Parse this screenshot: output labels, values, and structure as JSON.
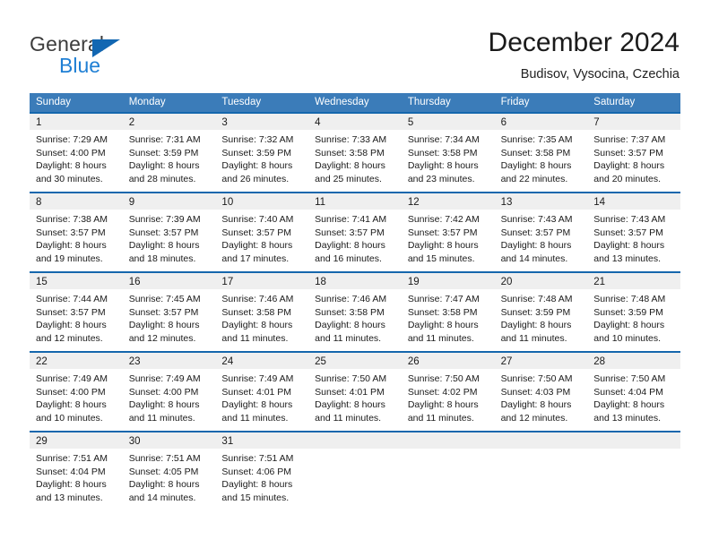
{
  "brand": {
    "name_part1": "General",
    "name_part2": "Blue",
    "triangle_color": "#1267b2",
    "blue_color": "#1f7fd4"
  },
  "header": {
    "title": "December 2024",
    "subtitle": "Budisov, Vysocina, Czechia"
  },
  "colors": {
    "header_row_bg": "#3b7cb9",
    "cell_top_border": "#1567ad",
    "day_band_bg": "#efefef"
  },
  "weekdays": [
    "Sunday",
    "Monday",
    "Tuesday",
    "Wednesday",
    "Thursday",
    "Friday",
    "Saturday"
  ],
  "weeks": [
    [
      {
        "day": "1",
        "sunrise": "Sunrise: 7:29 AM",
        "sunset": "Sunset: 4:00 PM",
        "daylight1": "Daylight: 8 hours",
        "daylight2": "and 30 minutes."
      },
      {
        "day": "2",
        "sunrise": "Sunrise: 7:31 AM",
        "sunset": "Sunset: 3:59 PM",
        "daylight1": "Daylight: 8 hours",
        "daylight2": "and 28 minutes."
      },
      {
        "day": "3",
        "sunrise": "Sunrise: 7:32 AM",
        "sunset": "Sunset: 3:59 PM",
        "daylight1": "Daylight: 8 hours",
        "daylight2": "and 26 minutes."
      },
      {
        "day": "4",
        "sunrise": "Sunrise: 7:33 AM",
        "sunset": "Sunset: 3:58 PM",
        "daylight1": "Daylight: 8 hours",
        "daylight2": "and 25 minutes."
      },
      {
        "day": "5",
        "sunrise": "Sunrise: 7:34 AM",
        "sunset": "Sunset: 3:58 PM",
        "daylight1": "Daylight: 8 hours",
        "daylight2": "and 23 minutes."
      },
      {
        "day": "6",
        "sunrise": "Sunrise: 7:35 AM",
        "sunset": "Sunset: 3:58 PM",
        "daylight1": "Daylight: 8 hours",
        "daylight2": "and 22 minutes."
      },
      {
        "day": "7",
        "sunrise": "Sunrise: 7:37 AM",
        "sunset": "Sunset: 3:57 PM",
        "daylight1": "Daylight: 8 hours",
        "daylight2": "and 20 minutes."
      }
    ],
    [
      {
        "day": "8",
        "sunrise": "Sunrise: 7:38 AM",
        "sunset": "Sunset: 3:57 PM",
        "daylight1": "Daylight: 8 hours",
        "daylight2": "and 19 minutes."
      },
      {
        "day": "9",
        "sunrise": "Sunrise: 7:39 AM",
        "sunset": "Sunset: 3:57 PM",
        "daylight1": "Daylight: 8 hours",
        "daylight2": "and 18 minutes."
      },
      {
        "day": "10",
        "sunrise": "Sunrise: 7:40 AM",
        "sunset": "Sunset: 3:57 PM",
        "daylight1": "Daylight: 8 hours",
        "daylight2": "and 17 minutes."
      },
      {
        "day": "11",
        "sunrise": "Sunrise: 7:41 AM",
        "sunset": "Sunset: 3:57 PM",
        "daylight1": "Daylight: 8 hours",
        "daylight2": "and 16 minutes."
      },
      {
        "day": "12",
        "sunrise": "Sunrise: 7:42 AM",
        "sunset": "Sunset: 3:57 PM",
        "daylight1": "Daylight: 8 hours",
        "daylight2": "and 15 minutes."
      },
      {
        "day": "13",
        "sunrise": "Sunrise: 7:43 AM",
        "sunset": "Sunset: 3:57 PM",
        "daylight1": "Daylight: 8 hours",
        "daylight2": "and 14 minutes."
      },
      {
        "day": "14",
        "sunrise": "Sunrise: 7:43 AM",
        "sunset": "Sunset: 3:57 PM",
        "daylight1": "Daylight: 8 hours",
        "daylight2": "and 13 minutes."
      }
    ],
    [
      {
        "day": "15",
        "sunrise": "Sunrise: 7:44 AM",
        "sunset": "Sunset: 3:57 PM",
        "daylight1": "Daylight: 8 hours",
        "daylight2": "and 12 minutes."
      },
      {
        "day": "16",
        "sunrise": "Sunrise: 7:45 AM",
        "sunset": "Sunset: 3:57 PM",
        "daylight1": "Daylight: 8 hours",
        "daylight2": "and 12 minutes."
      },
      {
        "day": "17",
        "sunrise": "Sunrise: 7:46 AM",
        "sunset": "Sunset: 3:58 PM",
        "daylight1": "Daylight: 8 hours",
        "daylight2": "and 11 minutes."
      },
      {
        "day": "18",
        "sunrise": "Sunrise: 7:46 AM",
        "sunset": "Sunset: 3:58 PM",
        "daylight1": "Daylight: 8 hours",
        "daylight2": "and 11 minutes."
      },
      {
        "day": "19",
        "sunrise": "Sunrise: 7:47 AM",
        "sunset": "Sunset: 3:58 PM",
        "daylight1": "Daylight: 8 hours",
        "daylight2": "and 11 minutes."
      },
      {
        "day": "20",
        "sunrise": "Sunrise: 7:48 AM",
        "sunset": "Sunset: 3:59 PM",
        "daylight1": "Daylight: 8 hours",
        "daylight2": "and 11 minutes."
      },
      {
        "day": "21",
        "sunrise": "Sunrise: 7:48 AM",
        "sunset": "Sunset: 3:59 PM",
        "daylight1": "Daylight: 8 hours",
        "daylight2": "and 10 minutes."
      }
    ],
    [
      {
        "day": "22",
        "sunrise": "Sunrise: 7:49 AM",
        "sunset": "Sunset: 4:00 PM",
        "daylight1": "Daylight: 8 hours",
        "daylight2": "and 10 minutes."
      },
      {
        "day": "23",
        "sunrise": "Sunrise: 7:49 AM",
        "sunset": "Sunset: 4:00 PM",
        "daylight1": "Daylight: 8 hours",
        "daylight2": "and 11 minutes."
      },
      {
        "day": "24",
        "sunrise": "Sunrise: 7:49 AM",
        "sunset": "Sunset: 4:01 PM",
        "daylight1": "Daylight: 8 hours",
        "daylight2": "and 11 minutes."
      },
      {
        "day": "25",
        "sunrise": "Sunrise: 7:50 AM",
        "sunset": "Sunset: 4:01 PM",
        "daylight1": "Daylight: 8 hours",
        "daylight2": "and 11 minutes."
      },
      {
        "day": "26",
        "sunrise": "Sunrise: 7:50 AM",
        "sunset": "Sunset: 4:02 PM",
        "daylight1": "Daylight: 8 hours",
        "daylight2": "and 11 minutes."
      },
      {
        "day": "27",
        "sunrise": "Sunrise: 7:50 AM",
        "sunset": "Sunset: 4:03 PM",
        "daylight1": "Daylight: 8 hours",
        "daylight2": "and 12 minutes."
      },
      {
        "day": "28",
        "sunrise": "Sunrise: 7:50 AM",
        "sunset": "Sunset: 4:04 PM",
        "daylight1": "Daylight: 8 hours",
        "daylight2": "and 13 minutes."
      }
    ],
    [
      {
        "day": "29",
        "sunrise": "Sunrise: 7:51 AM",
        "sunset": "Sunset: 4:04 PM",
        "daylight1": "Daylight: 8 hours",
        "daylight2": "and 13 minutes."
      },
      {
        "day": "30",
        "sunrise": "Sunrise: 7:51 AM",
        "sunset": "Sunset: 4:05 PM",
        "daylight1": "Daylight: 8 hours",
        "daylight2": "and 14 minutes."
      },
      {
        "day": "31",
        "sunrise": "Sunrise: 7:51 AM",
        "sunset": "Sunset: 4:06 PM",
        "daylight1": "Daylight: 8 hours",
        "daylight2": "and 15 minutes."
      },
      {
        "day": "",
        "sunrise": "",
        "sunset": "",
        "daylight1": "",
        "daylight2": ""
      },
      {
        "day": "",
        "sunrise": "",
        "sunset": "",
        "daylight1": "",
        "daylight2": ""
      },
      {
        "day": "",
        "sunrise": "",
        "sunset": "",
        "daylight1": "",
        "daylight2": ""
      },
      {
        "day": "",
        "sunrise": "",
        "sunset": "",
        "daylight1": "",
        "daylight2": ""
      }
    ]
  ]
}
